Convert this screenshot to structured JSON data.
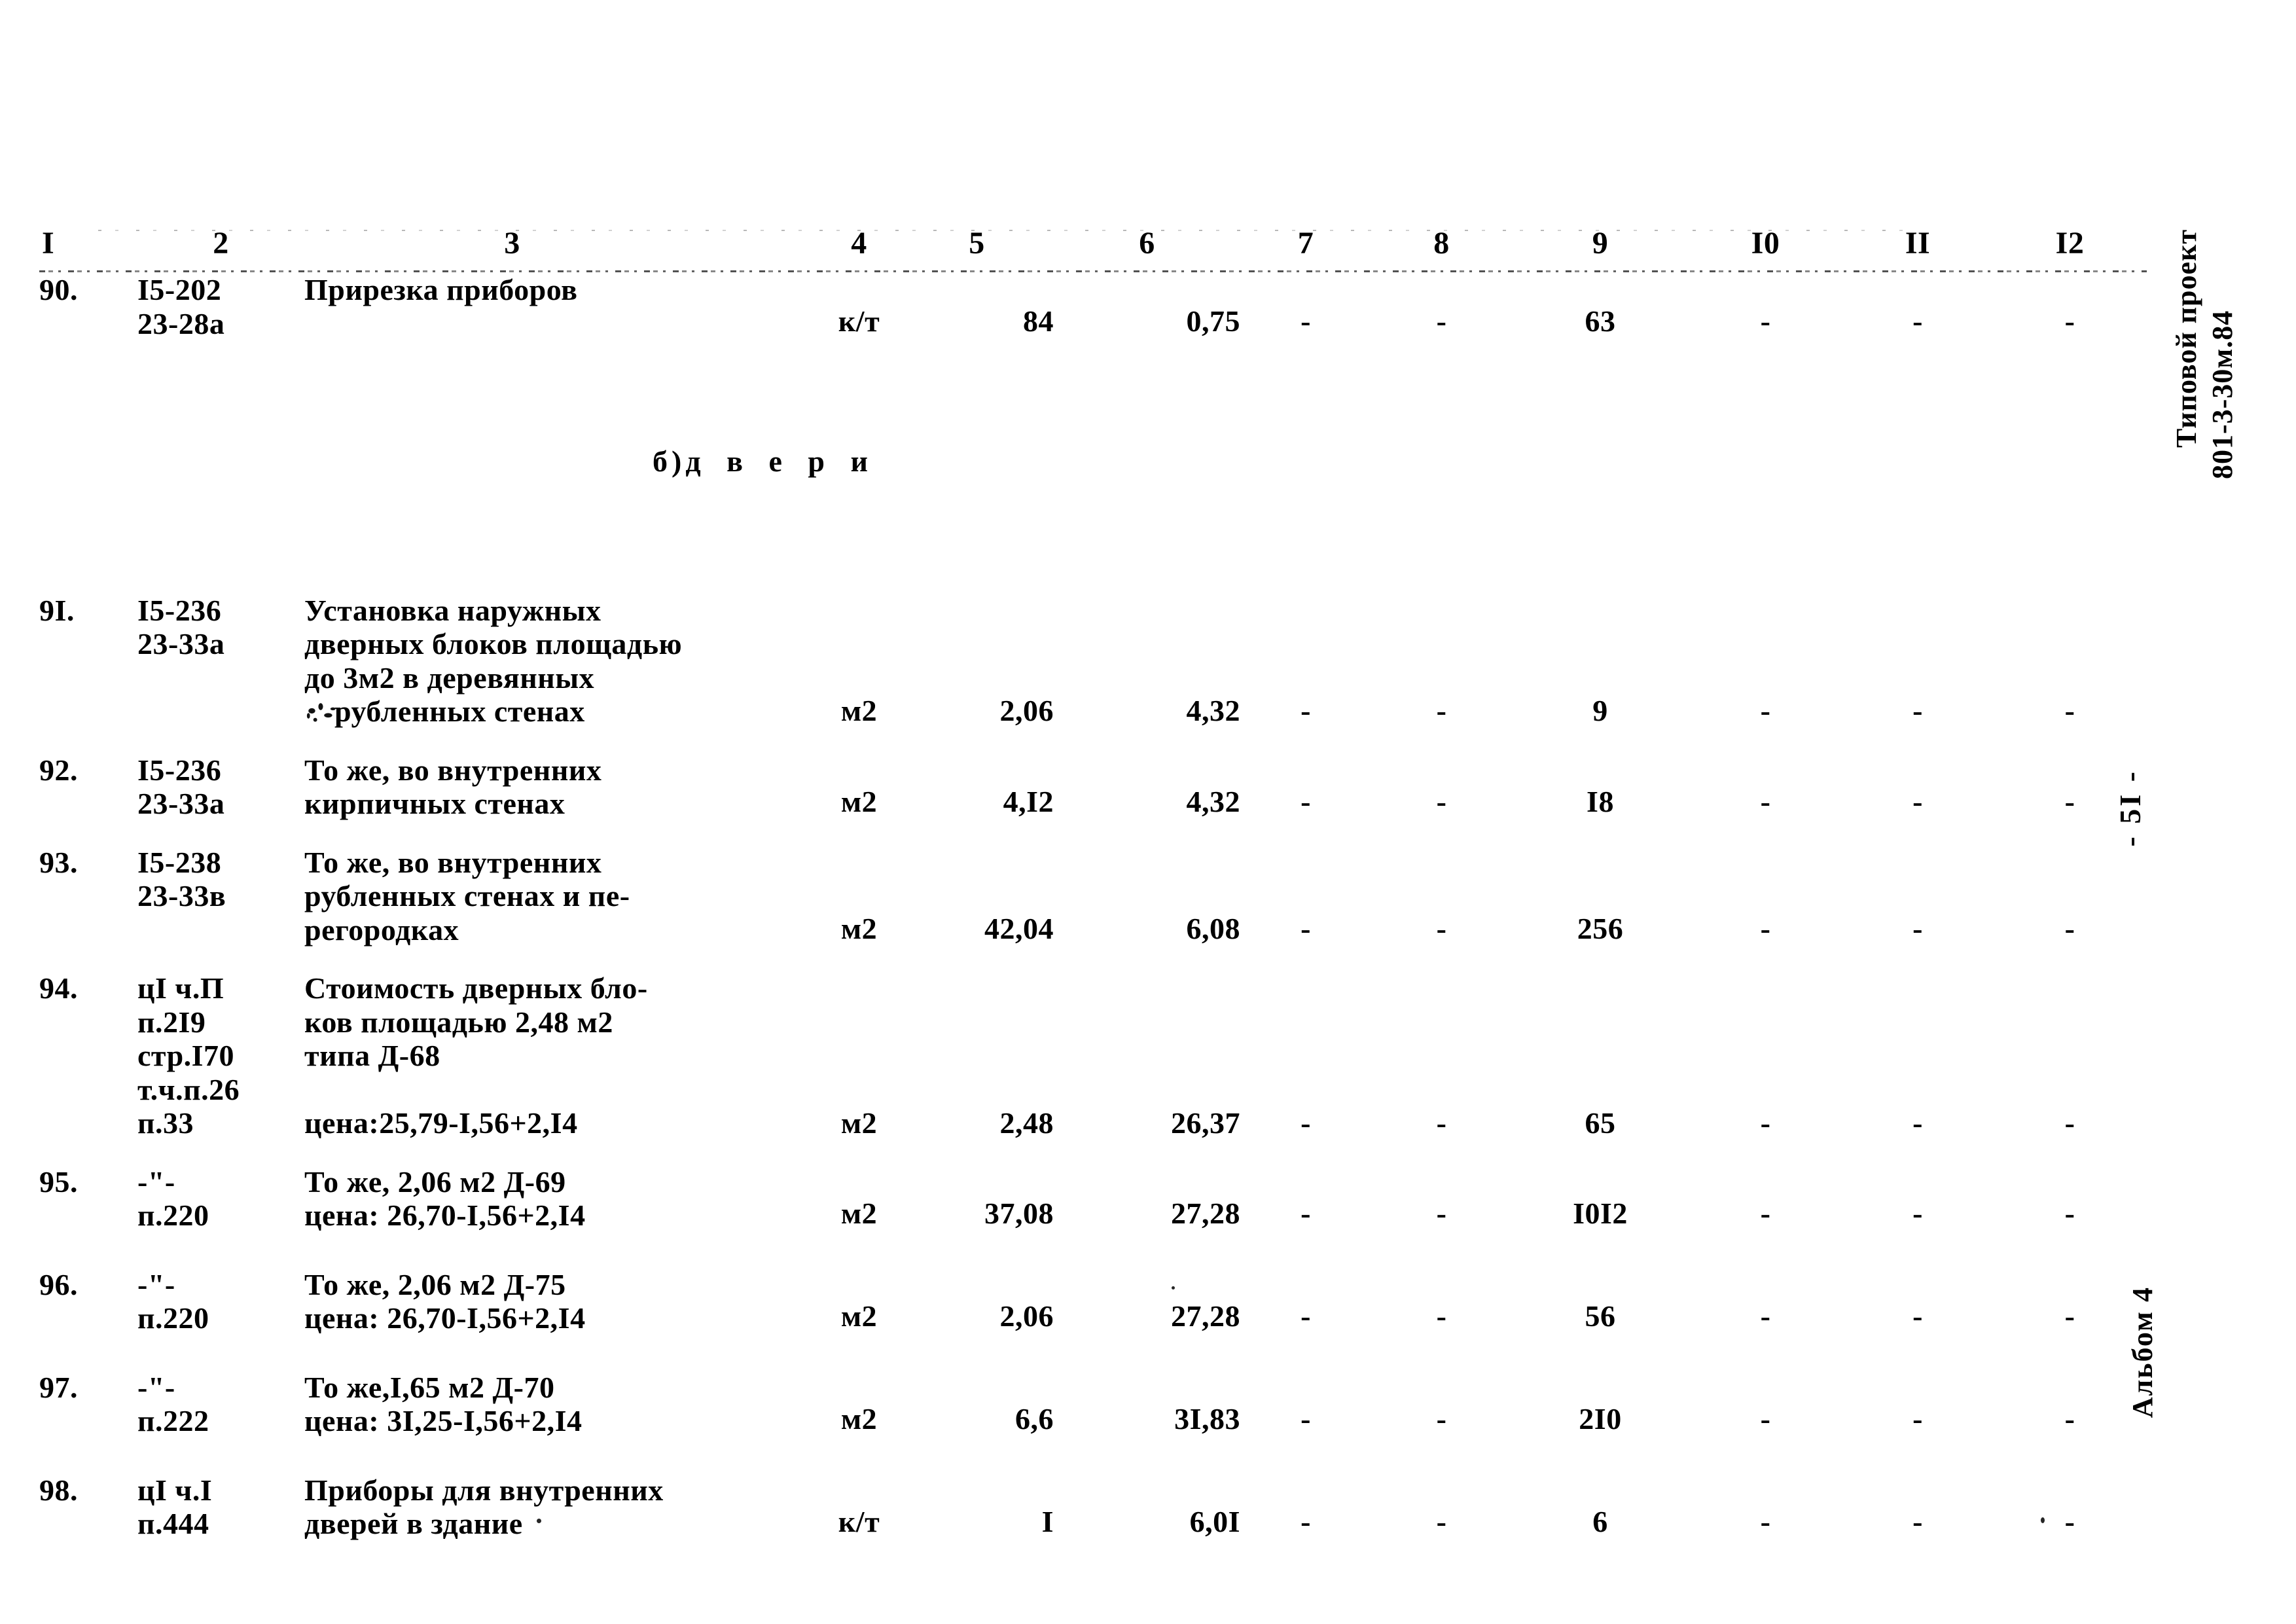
{
  "document": {
    "project_stamp_line1": "Типовой проект",
    "project_stamp_line2": "801-3-30м.84",
    "page_number": "- 5I -",
    "album_stamp": "Альбом 4"
  },
  "table": {
    "headers": [
      "I",
      "2",
      "3",
      "4",
      "5",
      "6",
      "7",
      "8",
      "9",
      "I0",
      "II",
      "I2"
    ],
    "subsection": {
      "marker": "б)",
      "label": "д в е р и"
    },
    "rows": [
      {
        "num": "90.",
        "code": "I5-202\n23-28а",
        "desc": "Прирезка приборов",
        "unit": "к/т",
        "qty": "84",
        "price": "0,75",
        "c7": "-",
        "c8": "-",
        "c9": "63",
        "c10": "-",
        "c11": "-",
        "c12": "-"
      },
      {
        "num": "9I.",
        "code": "I5-236\n23-33а",
        "desc": "Установка наружных\nдверных блоков площадью\nдо 3м2 в деревянных\nрубленных стенах",
        "desc_l1": "Установка наружных",
        "desc_l2": "дверных блоков площадью",
        "desc_l3": "до 3м2 в деревянных",
        "desc_l4": "рубленных стенах",
        "unit": "м2",
        "qty": "2,06",
        "price": "4,32",
        "c7": "-",
        "c8": "-",
        "c9": "9",
        "c10": "-",
        "c11": "-",
        "c12": "-"
      },
      {
        "num": "92.",
        "code": "I5-236\n23-33а",
        "desc": "То же, во внутренних\nкирпичных стенах",
        "unit": "м2",
        "qty": "4,I2",
        "price": "4,32",
        "c7": "-",
        "c8": "-",
        "c9": "I8",
        "c10": "-",
        "c11": "-",
        "c12": "-"
      },
      {
        "num": "93.",
        "code": "I5-238\n23-33в",
        "desc": "То же, во внутренних\nрубленных стенах и пе-\nрегородках",
        "unit": "м2",
        "qty": "42,04",
        "price": "6,08",
        "c7": "-",
        "c8": "-",
        "c9": "256",
        "c10": "-",
        "c11": "-",
        "c12": "-"
      },
      {
        "num": "94.",
        "code": "цI ч.П\nп.2I9\nстр.I70\nт.ч.п.26\nп.33",
        "desc": "Стоимость дверных бло-\nков площадью 2,48 м2\nтипа Д-68\n\nцена:25,79-I,56+2,I4",
        "unit": "м2",
        "qty": "2,48",
        "price": "26,37",
        "c7": "-",
        "c8": "-",
        "c9": "65",
        "c10": "-",
        "c11": "-",
        "c12": "-"
      },
      {
        "num": "95.",
        "code": "-\"-\nп.220",
        "desc": "То же, 2,06 м2 Д-69\nцена: 26,70-I,56+2,I4",
        "unit": "м2",
        "qty": "37,08",
        "price": "27,28",
        "c7": "-",
        "c8": "-",
        "c9": "I0I2",
        "c10": "-",
        "c11": "-",
        "c12": "-"
      },
      {
        "num": "96.",
        "code": "-\"-\nп.220",
        "desc": "То же, 2,06 м2 Д-75\nцена: 26,70-I,56+2,I4",
        "unit": "м2",
        "qty": "2,06",
        "price": "27,28",
        "c7": "-",
        "c8": "-",
        "c9": "56",
        "c10": "-",
        "c11": "-",
        "c12": "-"
      },
      {
        "num": "97.",
        "code": "-\"-\nп.222",
        "desc": "То же,I,65 м2 Д-70\nцена: 3I,25-I,56+2,I4",
        "unit": "м2",
        "qty": "6,6",
        "price": "3I,83",
        "c7": "-",
        "c8": "-",
        "c9": "2I0",
        "c10": "-",
        "c11": "-",
        "c12": "-"
      },
      {
        "num": "98.",
        "code": "цI ч.I\nп.444",
        "desc": "Приборы для внутренних\nдверей в здание",
        "unit": "к/т",
        "qty": "I",
        "price": "6,0I",
        "c7": "-",
        "c8": "-",
        "c9": "6",
        "c10": "-",
        "c11": "-",
        "c12": "-"
      }
    ]
  }
}
